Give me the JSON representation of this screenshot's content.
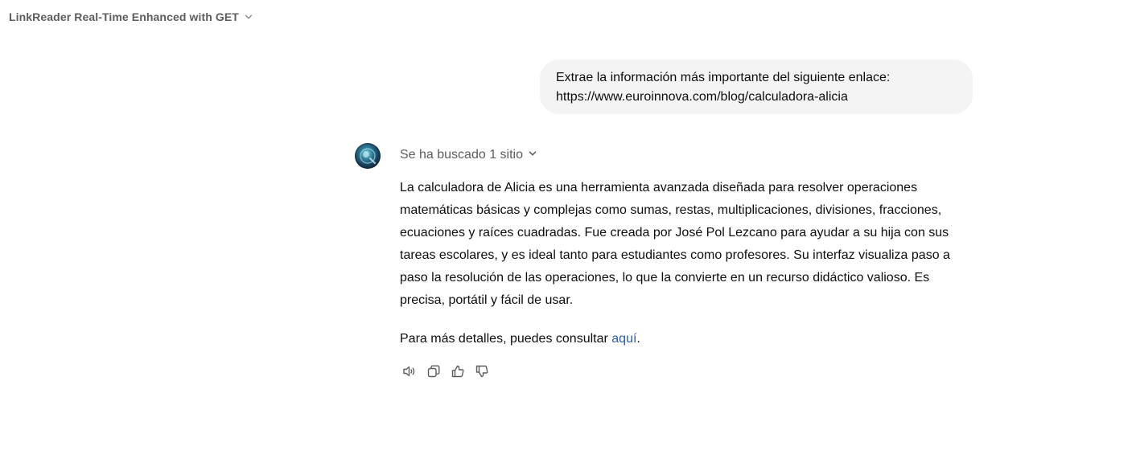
{
  "header": {
    "title": "LinkReader Real-Time Enhanced with GET",
    "dropdown_icon": "chevron-down-icon"
  },
  "conversation": {
    "user_message": {
      "line1": "Extrae la información más importante del siguiente enlace:",
      "line2": "https://www.euroinnova.com/blog/calculadora-alicia"
    },
    "assistant": {
      "search_status": "Se ha buscado 1 sitio",
      "paragraph1": "La calculadora de Alicia es una herramienta avanzada diseñada para resolver operaciones matemáticas básicas y complejas como sumas, restas, multiplicaciones, divisiones, fracciones, ecuaciones y raíces cuadradas. Fue creada por José Pol Lezcano para ayudar a su hija con sus tareas escolares, y es ideal tanto para estudiantes como profesores. Su interfaz visualiza paso a paso la resolución de las operaciones, lo que la convierte en un recurso didáctico valioso. Es precisa, portátil y fácil de usar.",
      "paragraph2_prefix": "Para más detalles, puedes consultar ",
      "paragraph2_link": "aquí",
      "paragraph2_suffix": "."
    }
  },
  "actions": [
    "read-aloud-icon",
    "copy-icon",
    "thumbs-up-icon",
    "thumbs-down-icon"
  ],
  "colors": {
    "bubble_bg": "#f4f4f4",
    "link": "#2a5cab",
    "muted_text": "#5d5d5d"
  }
}
